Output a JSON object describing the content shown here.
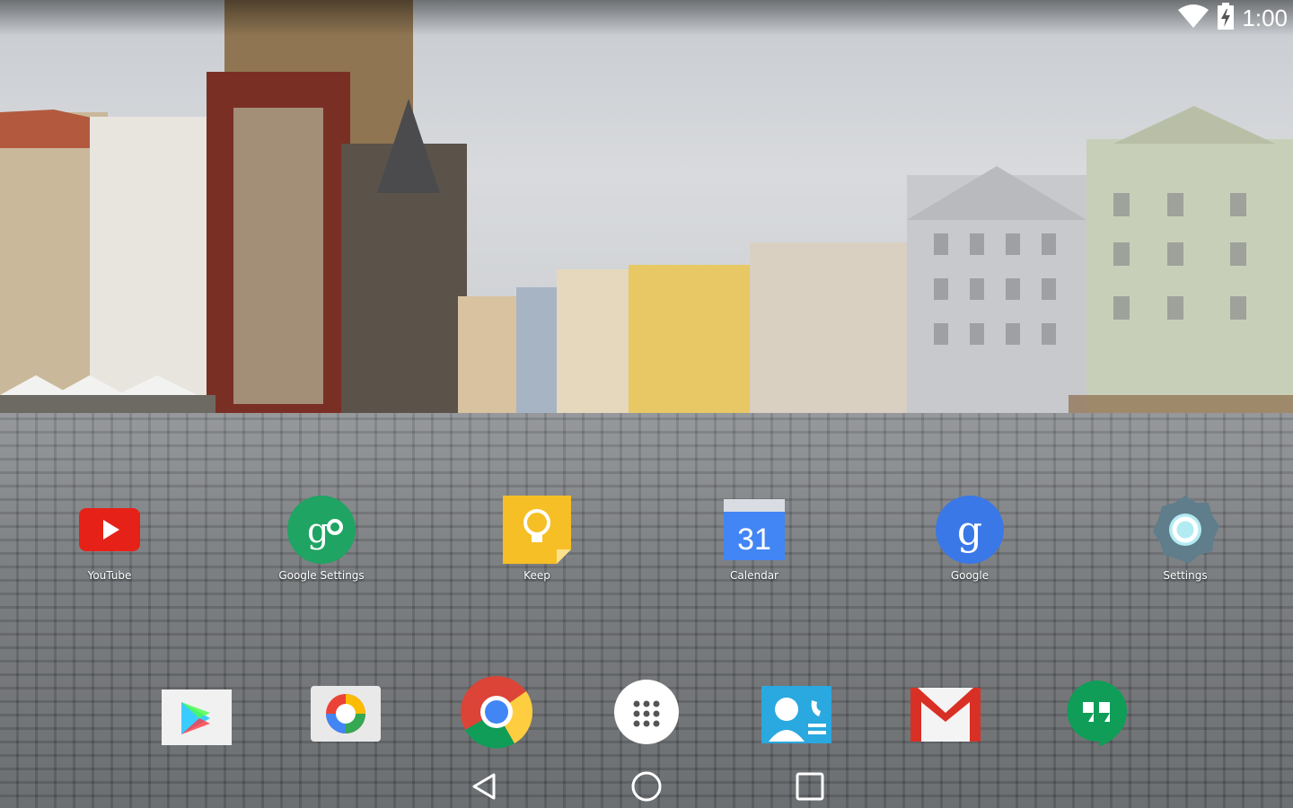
{
  "status_bar": {
    "time": "1:00",
    "wifi_icon": "wifi-icon",
    "battery_icon": "battery-charging-icon"
  },
  "home_apps": [
    {
      "label": "YouTube",
      "icon": "youtube-icon"
    },
    {
      "label": "Google Settings",
      "icon": "google-settings-icon"
    },
    {
      "label": "Keep",
      "icon": "keep-icon"
    },
    {
      "label": "Calendar",
      "icon": "calendar-icon",
      "badge_text": "31"
    },
    {
      "label": "Google",
      "icon": "google-icon",
      "badge_text": "g"
    },
    {
      "label": "Settings",
      "icon": "settings-icon"
    }
  ],
  "dock": [
    {
      "icon": "play-store-icon"
    },
    {
      "icon": "photos-icon"
    },
    {
      "icon": "chrome-icon"
    },
    {
      "icon": "app-drawer-icon"
    },
    {
      "icon": "contacts-icon"
    },
    {
      "icon": "gmail-icon"
    },
    {
      "icon": "hangouts-icon"
    }
  ],
  "nav": {
    "back": "back-icon",
    "home": "home-icon",
    "recents": "recents-icon"
  },
  "colors": {
    "youtube_red": "#e62117",
    "green": "#1fa463",
    "keep_yellow": "#f6bf26",
    "calendar_blue": "#4285f4",
    "google_blue": "#3b78e7",
    "settings_teal": "#607d8b"
  }
}
